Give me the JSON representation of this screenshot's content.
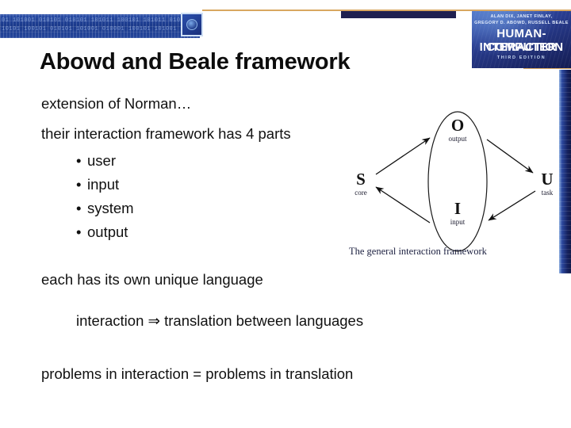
{
  "slide": {
    "title": "Abowd and Beale framework",
    "body": {
      "extension": "extension of Norman…",
      "parts_intro": "their interaction framework has 4 parts",
      "bullets": [
        {
          "marker": "•",
          "label": "user"
        },
        {
          "marker": "•",
          "label": "input"
        },
        {
          "marker": "•",
          "label": "system"
        },
        {
          "marker": "•",
          "label": "output"
        }
      ],
      "each_language": "each has its own unique language",
      "interaction_rule": "interaction ⇒  translation between languages",
      "problems_rule": "problems in interaction  =  problems in translation"
    }
  },
  "banner": {
    "bits_line1": "01 101001 010101 010101 101011 100101 101011 0101 110101 01",
    "bits_line2": "10101 100101 010101 101001 010001 100101 101001 010011 10",
    "badge_icon": "chip-badge-icon"
  },
  "book_cover": {
    "authors": "ALAN DIX, JANET FINLAY,\nGREGORY D. ABOWD, RUSSELL BEALE",
    "authors_line1": "ALAN DIX, JANET FINLAY,",
    "authors_line2": "GREGORY D. ABOWD, RUSSELL BEALE",
    "title_line1": "HUMAN-COMPUTER",
    "title_line2": "INTERACTION",
    "edition": "THIRD EDITION"
  },
  "diagram": {
    "caption": "The general interaction framework",
    "nodes": [
      {
        "id": "S",
        "letter": "S",
        "sublabel": "core"
      },
      {
        "id": "O",
        "letter": "O",
        "sublabel": "output"
      },
      {
        "id": "I",
        "letter": "I",
        "sublabel": "input"
      },
      {
        "id": "U",
        "letter": "U",
        "sublabel": "task"
      }
    ],
    "edges": [
      {
        "from": "S",
        "to": "O"
      },
      {
        "from": "O",
        "to": "U"
      },
      {
        "from": "U",
        "to": "I"
      },
      {
        "from": "I",
        "to": "S"
      }
    ]
  },
  "colors": {
    "gold_rule": "#d9a760",
    "navy_bar": "#1f2050",
    "banner_blue": "#1b3a8c",
    "text": "#111111"
  }
}
